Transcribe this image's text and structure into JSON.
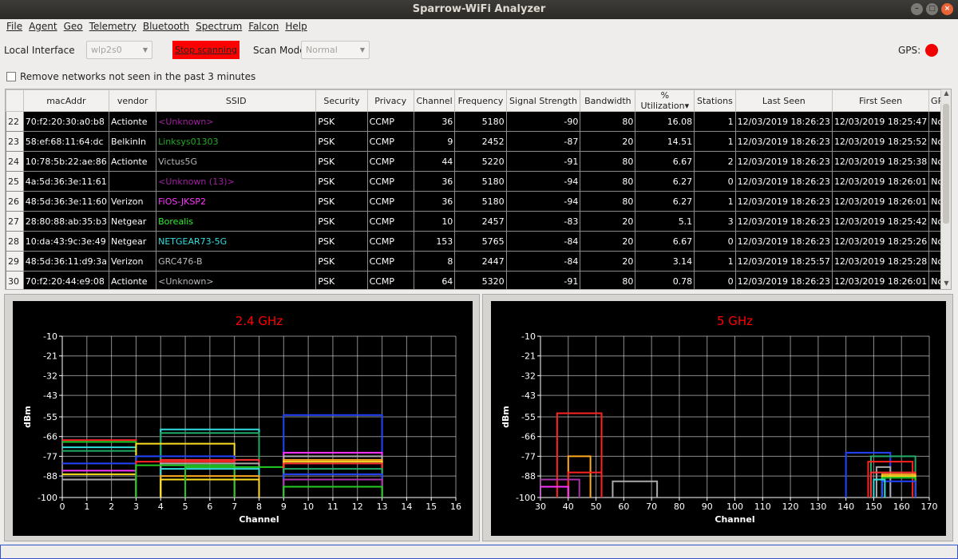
{
  "window": {
    "title": "Sparrow-WiFi Analyzer",
    "controls": [
      "–",
      "□",
      "×"
    ]
  },
  "menu": [
    "File",
    "Agent",
    "Geo",
    "Telemetry",
    "Bluetooth",
    "Spectrum",
    "Falcon",
    "Help"
  ],
  "toolbar": {
    "local_interface_label": "Local Interface",
    "interface_value": "wlp2s0",
    "stop_button": "Stop scanning",
    "scan_mode_label": "Scan Mode:",
    "scan_mode_value": "Normal",
    "gps_label": "GPS:",
    "gps_status_color": "#f20000",
    "remove_checkbox_label": "Remove networks not seen in the past 3 minutes",
    "remove_checked": false
  },
  "table": {
    "columns": [
      "macAddr",
      "vendor",
      "SSID",
      "Security",
      "Privacy",
      "Channel",
      "Frequency",
      "Signal Strength",
      "Bandwidth",
      "% Utilization",
      "Stations",
      "Last Seen",
      "First Seen",
      "GPS"
    ],
    "sort_column": "% Utilization",
    "rows": [
      {
        "n": "22",
        "mac": "70:f2:20:30:a0:b8",
        "vendor": "Actionte",
        "ssid": "<Unknown>",
        "ssid_color": "#a020a0",
        "sec": "PSK",
        "priv": "CCMP",
        "ch": "36",
        "freq": "5180",
        "sig": "-90",
        "bw": "80",
        "util": "16.08",
        "st": "1",
        "last": "12/03/2019 18:26:23",
        "first": "12/03/2019 18:25:47",
        "gps": "No"
      },
      {
        "n": "23",
        "mac": "58:ef:68:11:64:dc",
        "vendor": "BelkinIn",
        "ssid": "Linksys01303",
        "ssid_color": "#22aa22",
        "sec": "PSK",
        "priv": "CCMP",
        "ch": "9",
        "freq": "2452",
        "sig": "-87",
        "bw": "20",
        "util": "14.51",
        "st": "1",
        "last": "12/03/2019 18:26:23",
        "first": "12/03/2019 18:25:52",
        "gps": "No"
      },
      {
        "n": "24",
        "mac": "10:78:5b:22:ae:86",
        "vendor": "Actionte",
        "ssid": "Victus5G",
        "ssid_color": "#b8b8b8",
        "sec": "PSK",
        "priv": "CCMP",
        "ch": "44",
        "freq": "5220",
        "sig": "-91",
        "bw": "80",
        "util": "6.67",
        "st": "2",
        "last": "12/03/2019 18:26:23",
        "first": "12/03/2019 18:25:38",
        "gps": "No"
      },
      {
        "n": "25",
        "mac": "4a:5d:36:3e:11:61",
        "vendor": "",
        "ssid": "<Unknown (13)>",
        "ssid_color": "#a020a0",
        "sec": "PSK",
        "priv": "CCMP",
        "ch": "36",
        "freq": "5180",
        "sig": "-94",
        "bw": "80",
        "util": "6.27",
        "st": "0",
        "last": "12/03/2019 18:26:23",
        "first": "12/03/2019 18:26:01",
        "gps": "No"
      },
      {
        "n": "26",
        "mac": "48:5d:36:3e:11:60",
        "vendor": "Verizon",
        "ssid": "FiOS-JKSP2",
        "ssid_color": "#ff33ff",
        "sec": "PSK",
        "priv": "CCMP",
        "ch": "36",
        "freq": "5180",
        "sig": "-94",
        "bw": "80",
        "util": "6.27",
        "st": "1",
        "last": "12/03/2019 18:26:23",
        "first": "12/03/2019 18:26:01",
        "gps": "No"
      },
      {
        "n": "27",
        "mac": "28:80:88:ab:35:b3",
        "vendor": "Netgear",
        "ssid": "Borealis",
        "ssid_color": "#33ee33",
        "sec": "PSK",
        "priv": "CCMP",
        "ch": "10",
        "freq": "2457",
        "sig": "-83",
        "bw": "20",
        "util": "5.1",
        "st": "3",
        "last": "12/03/2019 18:26:23",
        "first": "12/03/2019 18:25:42",
        "gps": "No"
      },
      {
        "n": "28",
        "mac": "10:da:43:9c:3e:49",
        "vendor": "Netgear",
        "ssid": "NETGEAR73-5G",
        "ssid_color": "#33dddd",
        "sec": "PSK",
        "priv": "CCMP",
        "ch": "153",
        "freq": "5765",
        "sig": "-84",
        "bw": "20",
        "util": "6.67",
        "st": "0",
        "last": "12/03/2019 18:26:23",
        "first": "12/03/2019 18:25:26",
        "gps": "No"
      },
      {
        "n": "29",
        "mac": "48:5d:36:11:d9:3a",
        "vendor": "Verizon",
        "ssid": "GRC476-B",
        "ssid_color": "#b8b8b8",
        "sec": "PSK",
        "priv": "CCMP",
        "ch": "8",
        "freq": "2447",
        "sig": "-84",
        "bw": "20",
        "util": "3.14",
        "st": "1",
        "last": "12/03/2019 18:25:57",
        "first": "12/03/2019 18:25:28",
        "gps": "No"
      },
      {
        "n": "30",
        "mac": "70:f2:20:44:e9:08",
        "vendor": "Actionte",
        "ssid": "<Unknown>",
        "ssid_color": "#b8b8b8",
        "sec": "PSK",
        "priv": "CCMP",
        "ch": "64",
        "freq": "5320",
        "sig": "-91",
        "bw": "80",
        "util": "0.78",
        "st": "0",
        "last": "12/03/2019 18:26:23",
        "first": "12/03/2019 18:26:01",
        "gps": "No"
      }
    ]
  },
  "chart_data": [
    {
      "type": "line",
      "title": "2.4 GHz",
      "title_color": "#ff0000",
      "xlabel": "Channel",
      "ylabel": "dBm",
      "xlim": [
        0,
        16
      ],
      "ylim": [
        -100,
        -10
      ],
      "xticks": [
        0,
        1,
        2,
        3,
        4,
        5,
        6,
        7,
        8,
        9,
        10,
        11,
        12,
        13,
        14,
        15,
        16
      ],
      "yticks": [
        -10,
        -21,
        -32,
        -43,
        -55,
        -66,
        -77,
        -88,
        -100
      ],
      "grid": true,
      "networks": [
        {
          "x1": -1,
          "x2": 3,
          "y": -68,
          "color": "#ff2222"
        },
        {
          "x1": -1,
          "x2": 3,
          "y": -69,
          "color": "#22cc22"
        },
        {
          "x1": -1,
          "x2": 3,
          "y": -72,
          "color": "#33dddd"
        },
        {
          "x1": -1,
          "x2": 3,
          "y": -74,
          "color": "#22aa66"
        },
        {
          "x1": -1,
          "x2": 3,
          "y": -81,
          "color": "#2244ff"
        },
        {
          "x1": -1,
          "x2": 3,
          "y": -85,
          "color": "#ff33ff"
        },
        {
          "x1": -1,
          "x2": 3,
          "y": -87,
          "color": "#ffdd22"
        },
        {
          "x1": -1,
          "x2": 3,
          "y": -90,
          "color": "#aaaaaa"
        },
        {
          "x1": 4,
          "x2": 8,
          "y": -62,
          "color": "#33dddd"
        },
        {
          "x1": 4,
          "x2": 8,
          "y": -64,
          "color": "#22aa66"
        },
        {
          "x1": 3,
          "x2": 7,
          "y": -70,
          "color": "#ffdd22"
        },
        {
          "x1": 3,
          "x2": 7,
          "y": -77,
          "color": "#2244ff"
        },
        {
          "x1": 3,
          "x2": 7,
          "y": -80,
          "color": "#ff2222"
        },
        {
          "x1": 4,
          "x2": 8,
          "y": -79,
          "color": "#ff3333"
        },
        {
          "x1": 4,
          "x2": 8,
          "y": -81,
          "color": "#aaaaaa"
        },
        {
          "x1": 3,
          "x2": 7,
          "y": -82,
          "color": "#22cc22"
        },
        {
          "x1": 4,
          "x2": 8,
          "y": -84,
          "color": "#33dddd"
        },
        {
          "x1": 4,
          "x2": 8,
          "y": -88,
          "color": "#ffaa22"
        },
        {
          "x1": 4,
          "x2": 8,
          "y": -90,
          "color": "#ffdd22"
        },
        {
          "x1": 5,
          "x2": 9,
          "y": -83,
          "color": "#22cc22"
        },
        {
          "x1": 9,
          "x2": 13,
          "y": -54,
          "color": "#2244ff"
        },
        {
          "x1": 9,
          "x2": 13,
          "y": -75,
          "color": "#ff33ff"
        },
        {
          "x1": 9,
          "x2": 13,
          "y": -77,
          "color": "#aaaaaa"
        },
        {
          "x1": 9,
          "x2": 13,
          "y": -79,
          "color": "#ffaa22"
        },
        {
          "x1": 9,
          "x2": 13,
          "y": -80,
          "color": "#ffdd22"
        },
        {
          "x1": 9,
          "x2": 13,
          "y": -81,
          "color": "#ff3333"
        },
        {
          "x1": 9,
          "x2": 13,
          "y": -84,
          "color": "#22aa66"
        },
        {
          "x1": 9,
          "x2": 13,
          "y": -87,
          "color": "#2244ff"
        },
        {
          "x1": 9,
          "x2": 13,
          "y": -90,
          "color": "#aa33aa"
        },
        {
          "x1": 9,
          "x2": 13,
          "y": -94,
          "color": "#22cc22"
        }
      ]
    },
    {
      "type": "line",
      "title": "5 GHz",
      "title_color": "#ff0000",
      "xlabel": "Channel",
      "ylabel": "dBm",
      "xlim": [
        30,
        170
      ],
      "ylim": [
        -100,
        -10
      ],
      "xticks": [
        30,
        40,
        50,
        60,
        70,
        80,
        90,
        100,
        110,
        120,
        130,
        140,
        150,
        160,
        170
      ],
      "yticks": [
        -10,
        -21,
        -32,
        -43,
        -55,
        -66,
        -77,
        -88,
        -100
      ],
      "grid": true,
      "networks": [
        {
          "x1": 36,
          "x2": 52,
          "y": -53,
          "color": "#ff2222"
        },
        {
          "x1": 40,
          "x2": 48,
          "y": -77,
          "color": "#ffaa22"
        },
        {
          "x1": 40,
          "x2": 52,
          "y": -86,
          "color": "#ff2222"
        },
        {
          "x1": 30,
          "x2": 44,
          "y": -90,
          "color": "#aa33aa"
        },
        {
          "x1": 30,
          "x2": 40,
          "y": -94,
          "color": "#ff33ff"
        },
        {
          "x1": 56,
          "x2": 72,
          "y": -91,
          "color": "#aaaaaa"
        },
        {
          "x1": 140,
          "x2": 156,
          "y": -75,
          "color": "#2244ff"
        },
        {
          "x1": 149,
          "x2": 165,
          "y": -77,
          "color": "#22aa66"
        },
        {
          "x1": 148,
          "x2": 164,
          "y": -80,
          "color": "#ff2222"
        },
        {
          "x1": 151,
          "x2": 156,
          "y": -83,
          "color": "#aaaaaa"
        },
        {
          "x1": 149,
          "x2": 165,
          "y": -86,
          "color": "#ff3333"
        },
        {
          "x1": 153,
          "x2": 165,
          "y": -87,
          "color": "#ffaa22"
        },
        {
          "x1": 153,
          "x2": 165,
          "y": -88,
          "color": "#ffdd22"
        },
        {
          "x1": 153,
          "x2": 165,
          "y": -89,
          "color": "#22cc22"
        },
        {
          "x1": 153,
          "x2": 165,
          "y": -91,
          "color": "#2244ff"
        },
        {
          "x1": 150,
          "x2": 154,
          "y": -90,
          "color": "#33dddd"
        }
      ]
    }
  ]
}
